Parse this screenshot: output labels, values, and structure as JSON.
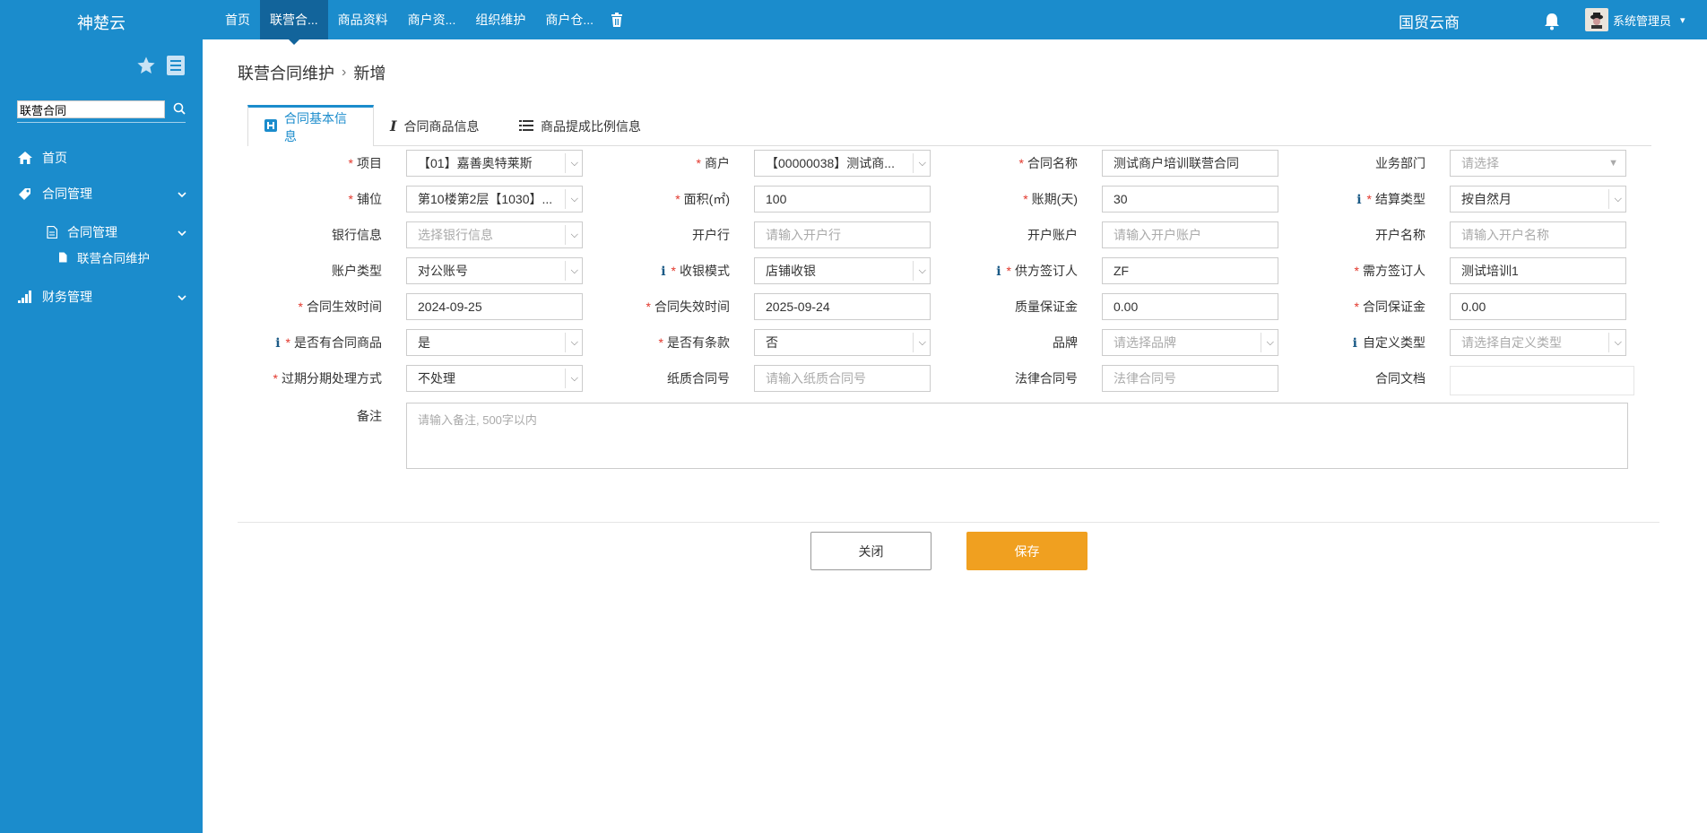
{
  "brand": "神楚云",
  "nav": [
    "首页",
    "联营合...",
    "商品资料",
    "商户资...",
    "组织维护",
    "商户仓..."
  ],
  "org_title": "国贸云商",
  "user": {
    "name": "系统管理员"
  },
  "sidebar": {
    "search_value": "联营合同",
    "menu": {
      "home": "首页",
      "contract_mgmt": "合同管理",
      "contract_mgmt_sub": "合同管理",
      "joint_contract": "联营合同维护",
      "finance": "财务管理"
    }
  },
  "breadcrumb": {
    "parent": "联营合同维护",
    "current": "新增"
  },
  "tabs": {
    "basic": "合同基本信息",
    "goods": "合同商品信息",
    "ratio": "商品提成比例信息"
  },
  "form": {
    "project": {
      "label": "项目",
      "value": "【01】嘉善奥特莱斯"
    },
    "merchant": {
      "label": "商户",
      "value": "【00000038】测试商..."
    },
    "contract_name": {
      "label": "合同名称",
      "value": "测试商户培训联营合同"
    },
    "dept": {
      "label": "业务部门",
      "placeholder": "请选择"
    },
    "shop": {
      "label": "铺位",
      "value": "第10楼第2层【1030】..."
    },
    "area": {
      "label": "面积(㎡)",
      "value": "100"
    },
    "period": {
      "label": "账期(天)",
      "value": "30"
    },
    "settle": {
      "label": "结算类型",
      "value": "按自然月"
    },
    "bank": {
      "label": "银行信息",
      "placeholder": "选择银行信息"
    },
    "open_bank": {
      "label": "开户行",
      "placeholder": "请输入开户行"
    },
    "open_account": {
      "label": "开户账户",
      "placeholder": "请输入开户账户"
    },
    "open_name": {
      "label": "开户名称",
      "placeholder": "请输入开户名称"
    },
    "account_type": {
      "label": "账户类型",
      "value": "对公账号"
    },
    "cash_mode": {
      "label": "收银模式",
      "value": "店铺收银"
    },
    "supplier_signer": {
      "label": "供方签订人",
      "value": "ZF"
    },
    "buyer_signer": {
      "label": "需方签订人",
      "value": "测试培训1"
    },
    "start_date": {
      "label": "合同生效时间",
      "value": "2024-09-25"
    },
    "end_date": {
      "label": "合同失效时间",
      "value": "2025-09-24"
    },
    "quality_deposit": {
      "label": "质量保证金",
      "value": "0.00"
    },
    "contract_deposit": {
      "label": "合同保证金",
      "value": "0.00"
    },
    "has_goods": {
      "label": "是否有合同商品",
      "value": "是"
    },
    "has_terms": {
      "label": "是否有条款",
      "value": "否"
    },
    "brand": {
      "label": "品牌",
      "placeholder": "请选择品牌"
    },
    "custom_type": {
      "label": "自定义类型",
      "placeholder": "请选择自定义类型"
    },
    "overdue": {
      "label": "过期分期处理方式",
      "value": "不处理"
    },
    "paper_no": {
      "label": "纸质合同号",
      "placeholder": "请输入纸质合同号"
    },
    "legal_no": {
      "label": "法律合同号",
      "placeholder": "法律合同号"
    },
    "doc": {
      "label": "合同文档"
    },
    "remark": {
      "label": "备注",
      "placeholder": "请输入备注, 500字以内"
    }
  },
  "buttons": {
    "close": "关闭",
    "save": "保存"
  },
  "colors": {
    "primary": "#1b8ccc",
    "primary_dark": "#12649b",
    "save": "#f0a020",
    "required": "#e2372c"
  }
}
